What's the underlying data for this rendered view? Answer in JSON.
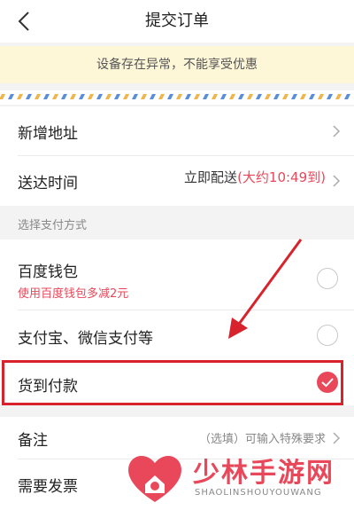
{
  "header": {
    "title": "提交订单",
    "back_icon": "back-chevron-icon"
  },
  "notice": {
    "text": "设备存在异常，不能享受优惠"
  },
  "address": {
    "label": "新增地址"
  },
  "delivery": {
    "label": "送达时间",
    "value": "立即配送",
    "accent": "(大约10:49到)"
  },
  "payment": {
    "section_title": "选择支付方式",
    "options": [
      {
        "label": "百度钱包",
        "promo": "使用百度钱包多减2元",
        "selected": false
      },
      {
        "label": "支付宝、微信支付等",
        "selected": false
      },
      {
        "label": "货到付款",
        "selected": true
      }
    ]
  },
  "remark": {
    "label": "备注",
    "value": "（选填）可输入特殊要求"
  },
  "invoice": {
    "label": "需要发票"
  },
  "watermark": {
    "title": "少林手游网",
    "subtitle": "SHAOLINSHOUYOUWANG"
  },
  "colors": {
    "accent": "#e8485a",
    "highlight_border": "#d8222c",
    "notice_bg": "#fdf7d8"
  }
}
